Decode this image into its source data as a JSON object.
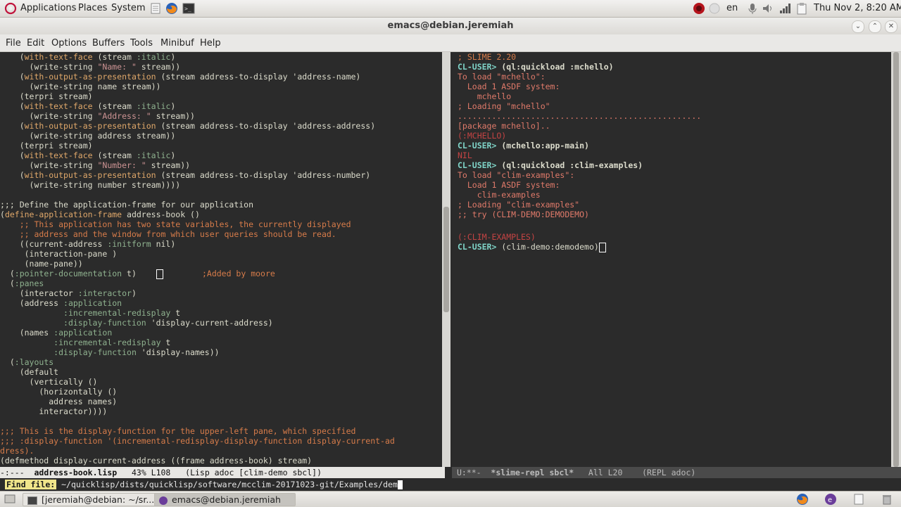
{
  "top_panel": {
    "applications": "Applications",
    "places": "Places",
    "system": "System",
    "lang": "en",
    "clock": "Thu Nov  2,  8:20 AM"
  },
  "window": {
    "title": "emacs@debian.jeremiah"
  },
  "menubar": [
    "File",
    "Edit",
    "Options",
    "Buffers",
    "Tools",
    "Minibuf",
    "Help"
  ],
  "left_code": [
    "    (with-text-face (stream :italic)",
    "      (write-string \"Name: \" stream))",
    "    (with-output-as-presentation (stream address-to-display 'address-name)",
    "      (write-string name stream))",
    "    (terpri stream)",
    "    (with-text-face (stream :italic)",
    "      (write-string \"Address: \" stream))",
    "    (with-output-as-presentation (stream address-to-display 'address-address)",
    "      (write-string address stream))",
    "    (terpri stream)",
    "    (with-text-face (stream :italic)",
    "      (write-string \"Number: \" stream))",
    "    (with-output-as-presentation (stream address-to-display 'address-number)",
    "      (write-string number stream))))",
    "",
    ";;; Define the application-frame for our application",
    "(define-application-frame address-book ()",
    "    ;; This application has two state variables, the currently displayed",
    "    ;; address and the window from which user queries should be read.",
    "    ((current-address :initform nil)",
    "     (interaction-pane )",
    "     (name-pane))",
    "  (:pointer-documentation t)                ;Added by moore",
    "  (:panes",
    "    (interactor :interactor)",
    "    (address :application",
    "             :incremental-redisplay t",
    "             :display-function 'display-current-address)",
    "    (names :application",
    "           :incremental-redisplay t",
    "           :display-function 'display-names))",
    "  (:layouts",
    "    (default",
    "      (vertically ()",
    "        (horizontally ()",
    "          address names)",
    "        interactor))))",
    "",
    ";;; This is the display-function for the upper-left pane, which specified",
    ";;; :display-function '(incremental-redisplay-display-function display-current-ad",
    "dress).",
    "(defmethod display-current-address ((frame address-book) stream)"
  ],
  "repl_lines": [
    "; SLIME 2.20",
    "CL-USER> (ql:quickload :mchello)",
    "To load \"mchello\":",
    "  Load 1 ASDF system:",
    "    mchello",
    "; Loading \"mchello\"",
    "..................................................",
    "[package mchello]..",
    "(:MCHELLO)",
    "CL-USER> (mchello:app-main)",
    "NIL",
    "CL-USER> (ql:quickload :clim-examples)",
    "To load \"clim-examples\":",
    "  Load 1 ASDF system:",
    "    clim-examples",
    "; Loading \"clim-examples\"",
    ";; try (CLIM-DEMO:DEMODEMO)",
    "",
    "(:CLIM-EXAMPLES)",
    "CL-USER> (clim-demo:demodemo)"
  ],
  "modeline_left": {
    "status": "-:---",
    "buffer": "address-book.lisp",
    "position": "43% L108",
    "mode": "(Lisp adoc [clim-demo sbcl])"
  },
  "modeline_right": {
    "status": "U:**-",
    "buffer": "*slime-repl sbcl*",
    "position": "All L20",
    "mode": "(REPL adoc)"
  },
  "minibuffer": {
    "prompt": "Find file:",
    "value": " ~/quicklisp/dists/quicklisp/software/mcclim-20171023-git/Examples/dem"
  },
  "taskbar": {
    "task1": "[jeremiah@debian: ~/sr...",
    "task2": "emacs@debian.jeremiah"
  }
}
